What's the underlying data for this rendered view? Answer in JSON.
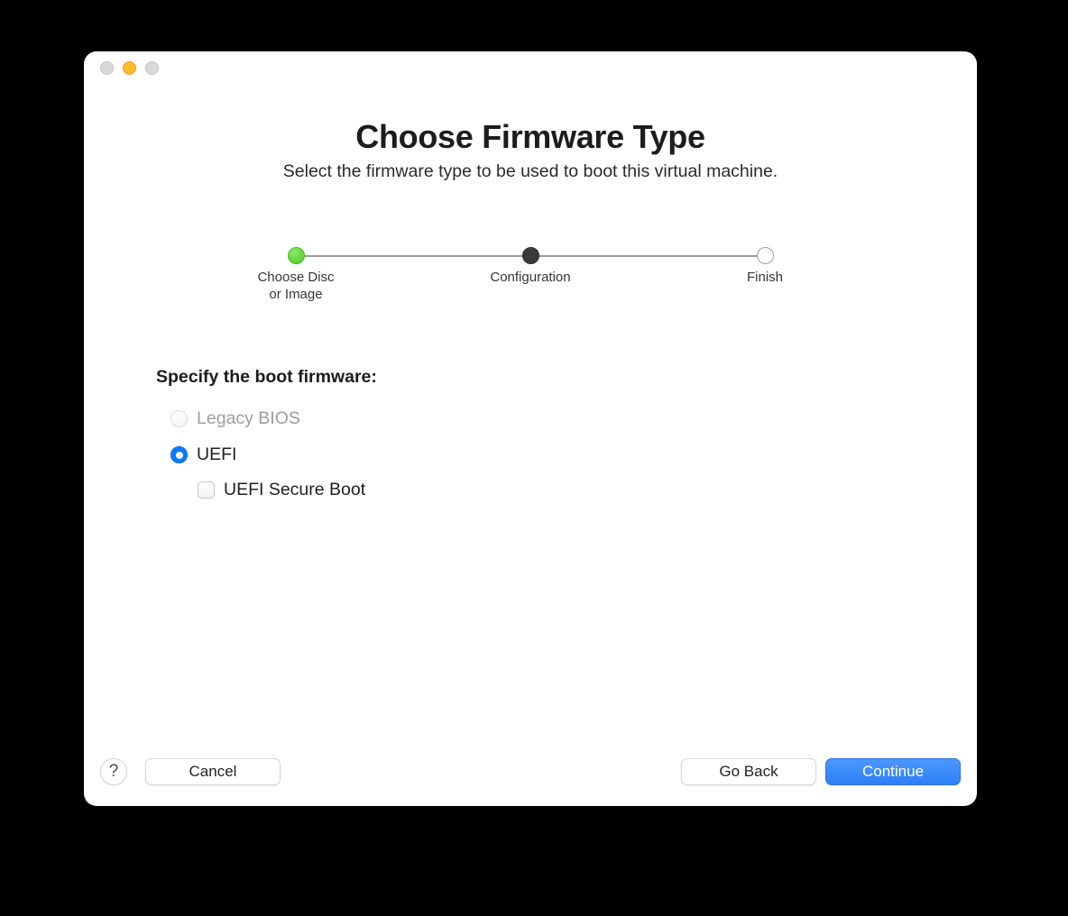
{
  "header": {
    "title": "Choose Firmware Type",
    "subtitle": "Select the firmware type to be used to boot this virtual machine."
  },
  "stepper": {
    "steps": [
      {
        "label": "Choose Disc\nor Image",
        "state": "done"
      },
      {
        "label": "Configuration",
        "state": "current"
      },
      {
        "label": "Finish",
        "state": "pending"
      }
    ]
  },
  "form": {
    "section_label": "Specify the boot firmware:",
    "options": {
      "legacy_bios": {
        "label": "Legacy BIOS",
        "selected": false,
        "disabled": true
      },
      "uefi": {
        "label": "UEFI",
        "selected": true,
        "disabled": false
      },
      "secure_boot": {
        "label": "UEFI Secure Boot",
        "checked": false
      }
    }
  },
  "footer": {
    "help": "?",
    "cancel": "Cancel",
    "go_back": "Go Back",
    "continue": "Continue"
  }
}
